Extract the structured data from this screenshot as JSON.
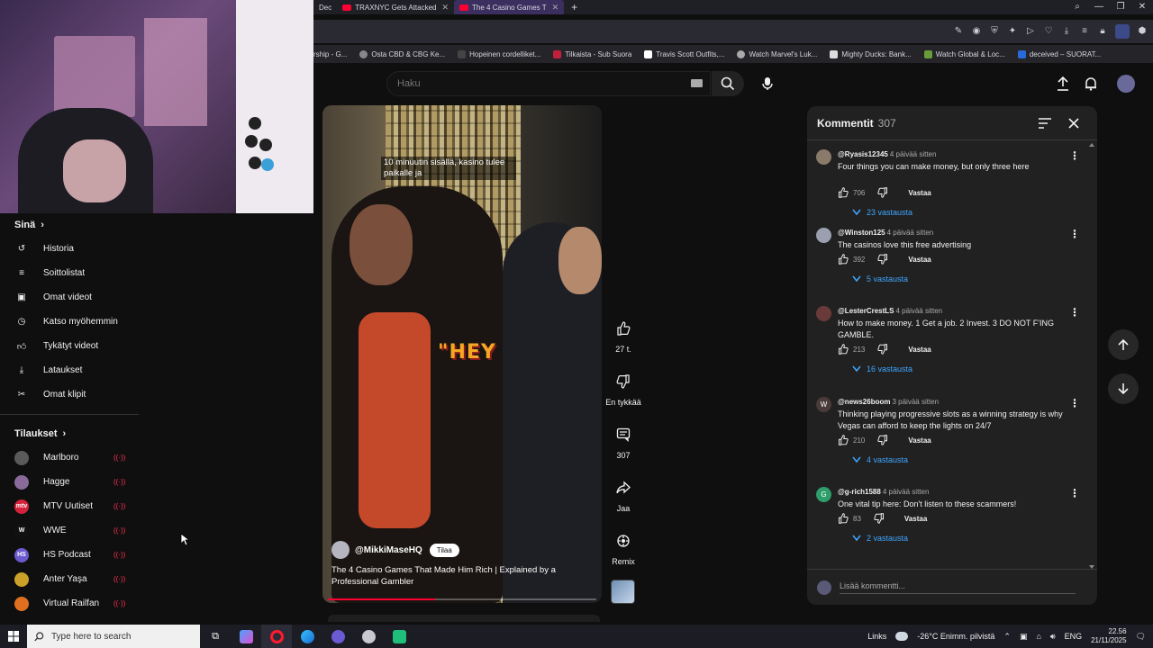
{
  "browser": {
    "tabs": [
      {
        "label": "Dec",
        "active": false
      },
      {
        "label": "TRAXNYC Gets Attacked",
        "active": false
      },
      {
        "label": "The 4 Casino Games T",
        "active": true
      }
    ],
    "new_tab": "+",
    "bookmarks": [
      {
        "label": "rship - G...",
        "icon": "page-icon"
      },
      {
        "label": "Osta CBD & CBG Ke...",
        "icon": "globe-icon"
      },
      {
        "label": "Hopeinen cordelliket...",
        "icon": "nt-icon"
      },
      {
        "label": "Tilkaista - Sub Suora",
        "icon": "tv-icon"
      },
      {
        "label": "Travis Scott Outfits,...",
        "icon": "t-icon"
      },
      {
        "label": "Watch Marvel's Luk...",
        "icon": "globe-icon"
      },
      {
        "label": "Mighty Ducks: Bank...",
        "icon": "pin-icon"
      },
      {
        "label": "Watch Global & Loc...",
        "icon": "gb-icon"
      },
      {
        "label": "deceived – SUORAT...",
        "icon": "doc-icon"
      }
    ]
  },
  "youtube": {
    "search_placeholder": "Haku"
  },
  "sidebar": {
    "you_heading": "Sinä",
    "you_items": [
      {
        "label": "Historia",
        "icon": "history-icon"
      },
      {
        "label": "Soittolistat",
        "icon": "playlists-icon"
      },
      {
        "label": "Omat videot",
        "icon": "your-videos-icon"
      },
      {
        "label": "Katso myöhemmin",
        "icon": "watch-later-icon"
      },
      {
        "label": "Tykätyt videot",
        "icon": "liked-videos-icon"
      },
      {
        "label": "Lataukset",
        "icon": "downloads-icon"
      },
      {
        "label": "Omat klipit",
        "icon": "clips-icon"
      }
    ],
    "subs_heading": "Tilaukset",
    "subs": [
      {
        "label": "Marlboro",
        "color": "#5a5a5a",
        "initials": ""
      },
      {
        "label": "Hagge",
        "color": "#8a6a9a",
        "initials": ""
      },
      {
        "label": "MTV Uutiset",
        "color": "#d4223a",
        "initials": "mtv"
      },
      {
        "label": "WWE",
        "color": "#111111",
        "initials": "W"
      },
      {
        "label": "HS Podcast",
        "color": "#6a5acd",
        "initials": "HS"
      },
      {
        "label": "Anter Yaşa",
        "color": "#c9a227",
        "initials": ""
      },
      {
        "label": "Virtual Railfan",
        "color": "#e07020",
        "initials": ""
      }
    ]
  },
  "video": {
    "caption": "10 minuutin sisällä, kasino tulee paikalle ja",
    "overlay_word": "\"HEY",
    "channel": "@MikkiMaseHQ",
    "subscribe_label": "Tilaa",
    "title": "The 4 Casino Games That Made Him Rich | Explained by a Professional Gambler",
    "progress_fraction": 0.4
  },
  "actions": {
    "like_count": "27 t.",
    "dislike_label": "En tykkää",
    "comment_count": "307",
    "share_label": "Jaa",
    "remix_label": "Remix"
  },
  "comments": {
    "title": "Kommentit",
    "count": "307",
    "add_placeholder": "Lisää kommentti...",
    "reply_label": "Vastaa",
    "items": [
      {
        "user": "@Ryasis12345",
        "time": "4 päivää sitten",
        "text": "Four things you can make money, but only three here",
        "likes": "706",
        "replies": "23 vastausta",
        "avatar_color": "#8a7a6a",
        "avatar_letter": ""
      },
      {
        "user": "@Winston125",
        "time": "4 päivää sitten",
        "text": "The casinos love this free advertising",
        "likes": "392",
        "replies": "5 vastausta",
        "avatar_color": "#9aa0b0",
        "avatar_letter": ""
      },
      {
        "user": "@LesterCrestLS",
        "time": "4 päivää sitten",
        "text": "How to make money. 1 Get a job. 2 Invest. 3 DO NOT F'ING GAMBLE.",
        "likes": "213",
        "replies": "16 vastausta",
        "avatar_color": "#6a3a3a",
        "avatar_letter": ""
      },
      {
        "user": "@news26boom",
        "time": "3 päivää sitten",
        "text": "Thinking playing progressive slots as a winning strategy is why Vegas can afford to keep the lights on 24/7",
        "likes": "210",
        "replies": "4 vastausta",
        "avatar_color": "#4a3a3a",
        "avatar_letter": "W"
      },
      {
        "user": "@g-rich1588",
        "time": "4 päivää sitten",
        "text": "One vital tip here: Don't listen to these scammers!",
        "likes": "83",
        "replies": "2 vastausta",
        "avatar_color": "#2f9e6a",
        "avatar_letter": "G"
      }
    ]
  },
  "taskbar": {
    "search_placeholder": "Type here to search",
    "links_label": "Links",
    "weather": "-26°C Enimm. pilvistä",
    "language": "ENG",
    "time": "22.56",
    "date": "21/11/2025"
  }
}
